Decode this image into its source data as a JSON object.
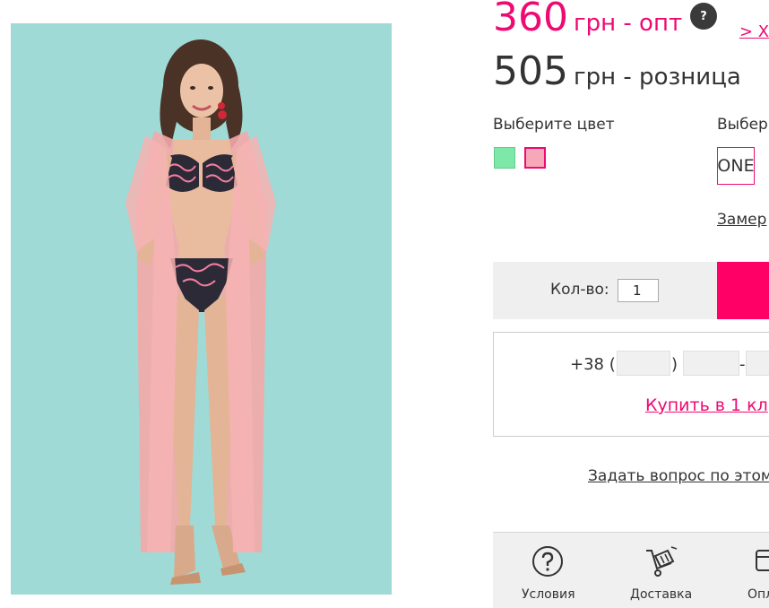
{
  "price": {
    "wholesale_value": "360",
    "wholesale_label": "грн - опт",
    "help_badge": "?",
    "close_link": "> Х",
    "retail_value": "505",
    "retail_label": "грн - розница"
  },
  "color": {
    "label": "Выберите цвет",
    "swatches": [
      {
        "name": "green",
        "hex": "#7ee8a8"
      },
      {
        "name": "pink",
        "hex": "#f7a8b8",
        "selected": true
      }
    ]
  },
  "size": {
    "label": "Выбер",
    "selected": "ONE",
    "measure_link": "Замер"
  },
  "quantity": {
    "label": "Кол-во:",
    "value": "1"
  },
  "one_click": {
    "phone_prefix": "+38 (",
    "paren_close": ")",
    "dash": "-",
    "buy_label": "Купить в 1 кл"
  },
  "ask_question": "Задать вопрос по этом",
  "info_tabs": [
    {
      "label": "Условия",
      "icon": "question-circle-icon"
    },
    {
      "label": "Доставка",
      "icon": "delivery-cart-icon"
    },
    {
      "label": "Опл",
      "icon": "wallet-icon"
    }
  ],
  "colors": {
    "accent": "#ee0a73",
    "buy_button": "#ff0066",
    "photo_background": "#9fdad6"
  }
}
